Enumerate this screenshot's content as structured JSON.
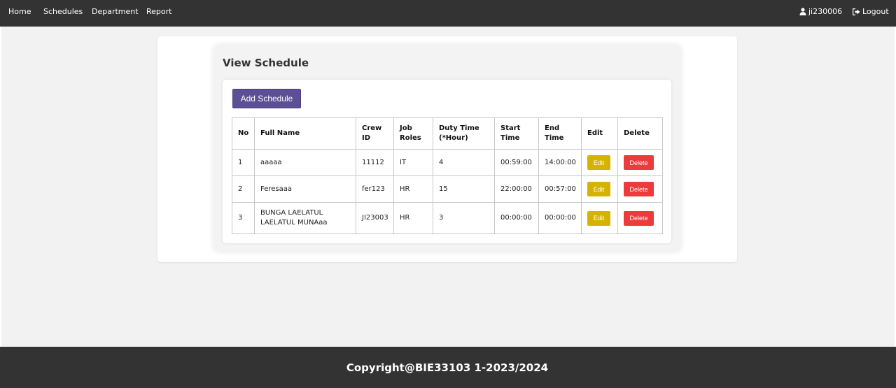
{
  "nav": {
    "items": [
      {
        "label": "Home"
      },
      {
        "label": "Schedules"
      },
      {
        "label": "Department"
      },
      {
        "label": "Report"
      }
    ],
    "user": "ji230006",
    "logout": "Logout",
    "user_icon": "user-icon",
    "logout_icon": "sign-out-icon"
  },
  "main": {
    "title": "View Schedule",
    "add_button": "Add Schedule",
    "table": {
      "headers": [
        "No",
        "Full Name",
        "Crew ID",
        "Job Roles",
        "Duty Time (*Hour)",
        "Start Time",
        "End Time",
        "Edit",
        "Delete"
      ],
      "rows": [
        {
          "no": "1",
          "name": "aaaaa",
          "crew_id": "11112",
          "role": "IT",
          "duty": "4",
          "start": "00:59:00",
          "end": "14:00:00",
          "edit": "Edit",
          "delete": "Delete"
        },
        {
          "no": "2",
          "name": "Feresaaa",
          "crew_id": "fer123",
          "role": "HR",
          "duty": "15",
          "start": "22:00:00",
          "end": "00:57:00",
          "edit": "Edit",
          "delete": "Delete"
        },
        {
          "no": "3",
          "name": "BUNGA LAELATUL LAELATUL MUNAaa",
          "crew_id": "JI23003",
          "role": "HR",
          "duty": "3",
          "start": "00:00:00",
          "end": "00:00:00",
          "edit": "Edit",
          "delete": "Delete"
        }
      ]
    }
  },
  "footer": {
    "text": "Copyright@BIE33103 1-2023/2024"
  },
  "colors": {
    "navbar": "#333333",
    "primary_button": "#5c4f96",
    "edit_button": "#d6b300",
    "delete_button": "#ec3b3b"
  }
}
